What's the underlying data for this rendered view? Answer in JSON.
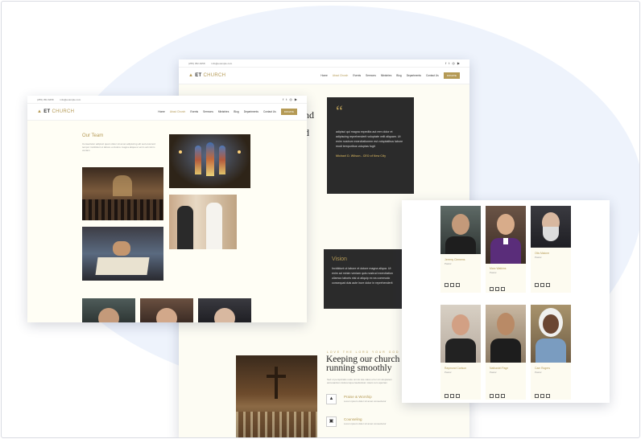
{
  "brand": {
    "logo_prefix": "ET",
    "logo_suffix": "CHURCH",
    "accent": "#b59a55"
  },
  "topbar": {
    "phone": "(255) 352-6258",
    "email": "info@example.com"
  },
  "nav": {
    "items": [
      "Home",
      "About Church",
      "Events",
      "Sermons",
      "Ministries",
      "Blog",
      "Departments",
      "Contact Us"
    ],
    "donate": "DONATE"
  },
  "left_page": {
    "heading": "Our Team",
    "intro": "Consectetur adipisci quam dolor sit amet adipiscing elit sed eiusmod tempor incididunt ut labore et dolore magna aliqua ut enim ad minim veniam"
  },
  "center_page": {
    "hero_fragment": "nd",
    "quote_mark": "“",
    "quote_text": "adipisci qui magna expedita aut rem dolor et adipiscing reprehenderit voluptate velit aliquam. Ut enim nostrum exercitationem est voluptatibus labore modi temporibus voluptas fugit",
    "quote_author": "Michael D. Wilson - CEO of New City",
    "vision_title": "Vision",
    "vision_text": "Incididunt ut labore et dolore magna aliqua. Ut enim ad minim veniam quis nostrud exercitation ullamco laboris nisi ut aliquip ex ea commodo consequat duis aute irure dolor in reprehenderit",
    "eyebrow": "LOVE THE LORD YOUR GOD",
    "heading": "Keeping our church running smoothly",
    "body": "Sed ut perspiciatis unde omnis iste natus error sit voluptatem accusantium doloremque laudantium totam rem aperiam",
    "features": [
      {
        "title": "Praise & Worship",
        "text": "Lorem ipsum dolor sit amet consectetur"
      },
      {
        "title": "Counseling",
        "text": "Lorem ipsum dolor sit amet consectetur"
      }
    ]
  },
  "team": [
    {
      "name": "Jeremy Clemens",
      "role": "Pastor"
    },
    {
      "name": "Marc Watkins",
      "role": "Pastor"
    },
    {
      "name": "Otis Malone",
      "role": "Pastor"
    },
    {
      "name": "Raymond Carlson",
      "role": "Pastor"
    },
    {
      "name": "Nathaniel Page",
      "role": "Pastor"
    },
    {
      "name": "Cam Rogers",
      "role": "Pastor"
    }
  ]
}
